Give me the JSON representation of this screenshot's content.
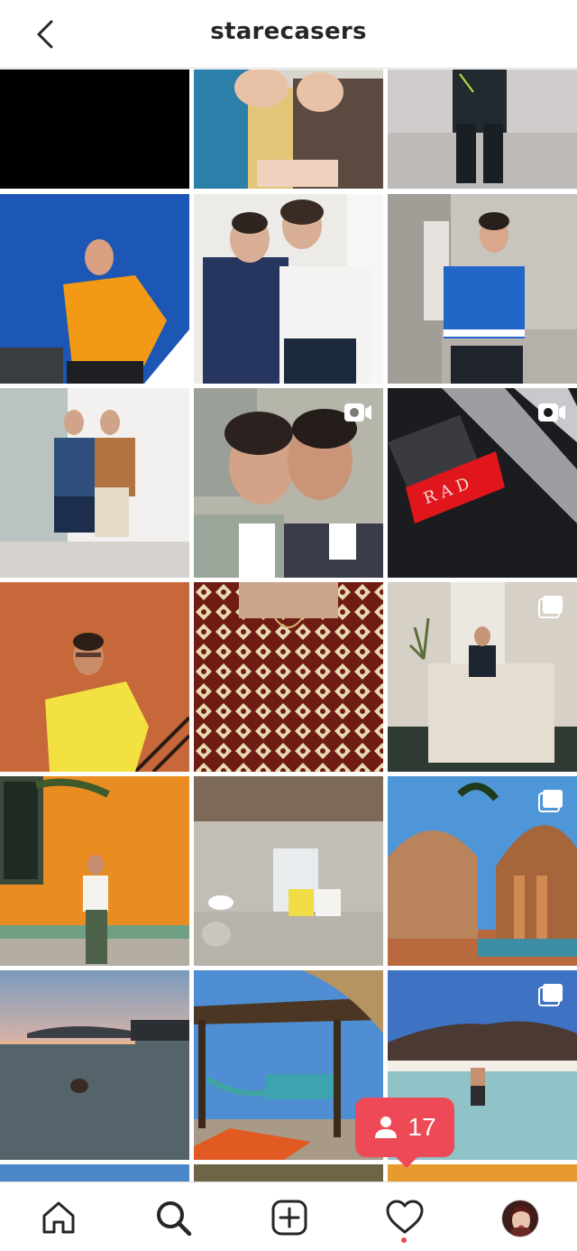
{
  "header": {
    "username": "starecasers",
    "back_icon": "chevron-left-icon"
  },
  "grid": {
    "rows": [
      [
        "black image",
        "two men sweaters",
        "man standing courtyard"
      ],
      [
        "orange fleece blue sky",
        "two men embracing",
        "blue striped tank"
      ],
      [
        "two men white wall",
        "two men kissing video",
        "red bracelet video"
      ],
      [
        "yellow shirt orange wall",
        "patterned shirt",
        "interior counter carousel"
      ],
      [
        "orange wall courtyard",
        "concrete pavilion",
        "curved architecture carousel"
      ],
      [
        "infinity pool sunset",
        "palapa hammock",
        "beach desert carousel"
      ]
    ],
    "badges": {
      "video": "video-icon",
      "carousel": "carousel-icon"
    }
  },
  "notification": {
    "icon": "person-icon",
    "count": "17"
  },
  "bottom_nav": {
    "items": [
      "home-icon",
      "search-icon",
      "new-post-icon",
      "activity-heart-icon",
      "profile-avatar"
    ]
  },
  "colors": {
    "badge": "#ed4956",
    "divider": "#dbdbdb",
    "text": "#262626"
  }
}
